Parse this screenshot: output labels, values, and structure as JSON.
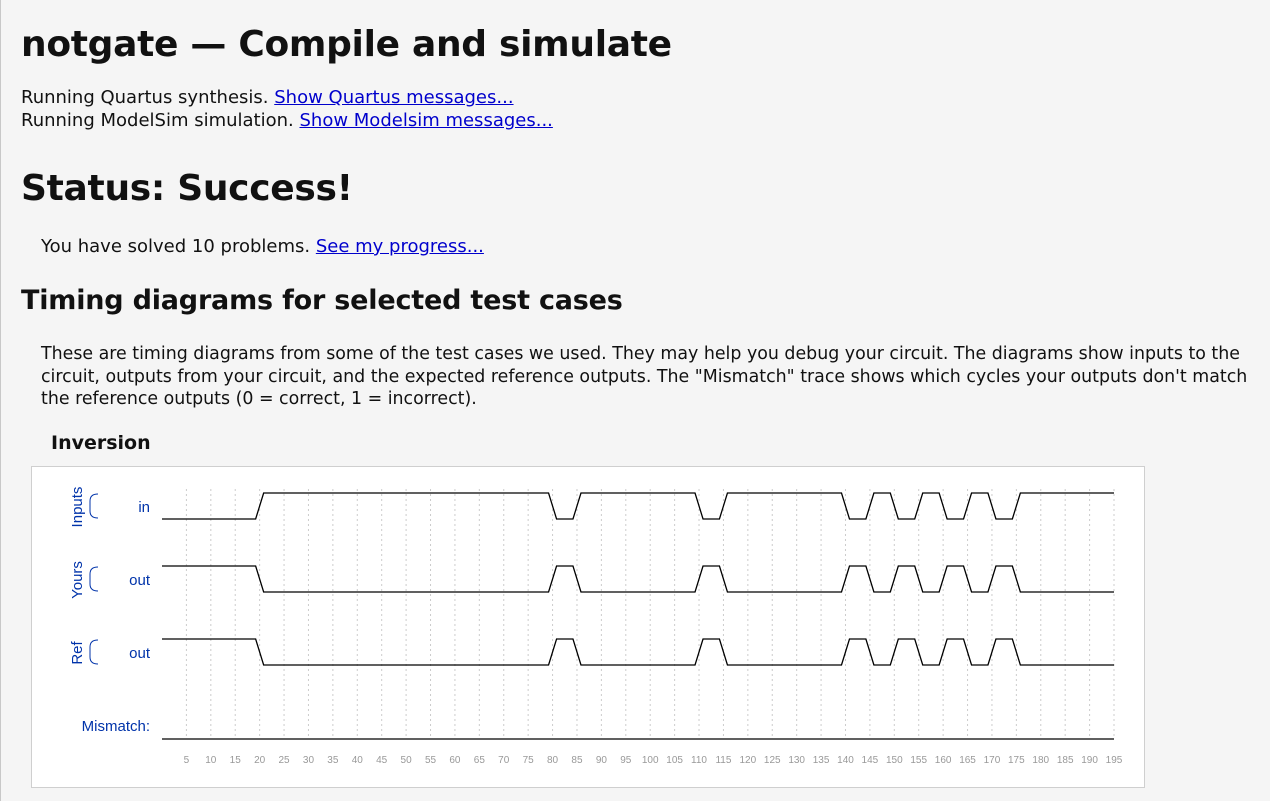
{
  "page": {
    "title": "notgate — Compile and simulate",
    "line1_text": "Running Quartus synthesis. ",
    "line1_link": "Show Quartus messages...",
    "line2_text": "Running ModelSim simulation. ",
    "line2_link": "Show Modelsim messages...",
    "status_heading": "Status: Success!",
    "solved_text": "You have solved 10 problems. ",
    "solved_link": "See my progress...",
    "timing_heading": "Timing diagrams for selected test cases",
    "description": "These are timing diagrams from some of the test cases we used. They may help you debug your circuit. The diagrams show inputs to the circuit, outputs from your circuit, and the expected reference outputs. The \"Mismatch\" trace shows which cycles your outputs don't match the reference outputs (0 = correct, 1 = incorrect).",
    "diagram_title": "Inversion"
  },
  "chart_data": {
    "type": "timing",
    "groups": [
      {
        "label": "Inputs",
        "signals": [
          "in"
        ]
      },
      {
        "label": "Yours",
        "signals": [
          "out"
        ]
      },
      {
        "label": "Ref",
        "signals": [
          "out"
        ]
      }
    ],
    "mismatch_label": "Mismatch:",
    "time_ticks": [
      5,
      10,
      15,
      20,
      25,
      30,
      35,
      40,
      45,
      50,
      55,
      60,
      65,
      70,
      75,
      80,
      85,
      90,
      95,
      100,
      105,
      110,
      115,
      120,
      125,
      130,
      135,
      140,
      145,
      150,
      155,
      160,
      165,
      170,
      175,
      180,
      185,
      190,
      195
    ],
    "t_start": 0,
    "t_end": 195,
    "signals": [
      {
        "group": "Inputs",
        "name": "in",
        "initial": 0,
        "transitions": [
          [
            20,
            1
          ],
          [
            80,
            0
          ],
          [
            85,
            1
          ],
          [
            110,
            0
          ],
          [
            115,
            1
          ],
          [
            140,
            0
          ],
          [
            145,
            1
          ],
          [
            150,
            0
          ],
          [
            155,
            1
          ],
          [
            160,
            0
          ],
          [
            165,
            1
          ],
          [
            170,
            0
          ],
          [
            175,
            1
          ]
        ]
      },
      {
        "group": "Yours",
        "name": "out",
        "initial": 1,
        "transitions": [
          [
            20,
            0
          ],
          [
            80,
            1
          ],
          [
            85,
            0
          ],
          [
            110,
            1
          ],
          [
            115,
            0
          ],
          [
            140,
            1
          ],
          [
            145,
            0
          ],
          [
            150,
            1
          ],
          [
            155,
            0
          ],
          [
            160,
            1
          ],
          [
            165,
            0
          ],
          [
            170,
            1
          ],
          [
            175,
            0
          ]
        ]
      },
      {
        "group": "Ref",
        "name": "out",
        "initial": 1,
        "transitions": [
          [
            20,
            0
          ],
          [
            80,
            1
          ],
          [
            85,
            0
          ],
          [
            110,
            1
          ],
          [
            115,
            0
          ],
          [
            140,
            1
          ],
          [
            145,
            0
          ],
          [
            150,
            1
          ],
          [
            155,
            0
          ],
          [
            160,
            1
          ],
          [
            165,
            0
          ],
          [
            170,
            1
          ],
          [
            175,
            0
          ]
        ]
      }
    ],
    "mismatch": {
      "initial": 0,
      "transitions": []
    },
    "colors": {
      "label": "#0033aa",
      "trace": "#000000",
      "grid": "#cccccc",
      "tick": "#999999"
    }
  }
}
